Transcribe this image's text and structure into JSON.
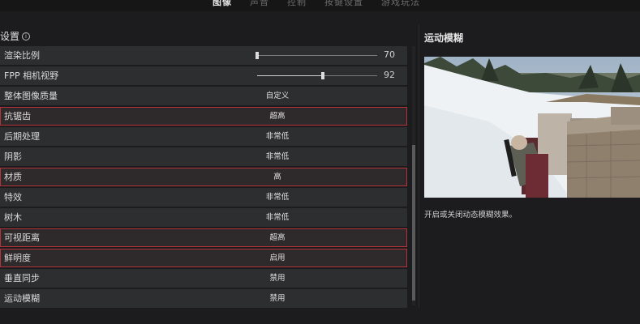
{
  "tabs": [
    {
      "label": "图像",
      "active": true
    },
    {
      "label": "声音",
      "active": false
    },
    {
      "label": "控制",
      "active": false
    },
    {
      "label": "按键设置",
      "active": false
    },
    {
      "label": "游戏玩法",
      "active": false
    }
  ],
  "section": {
    "title": "设置",
    "info_icon": "info-icon"
  },
  "settings": [
    {
      "label": "渲染比例",
      "type": "slider",
      "value": "70",
      "fraction": 0.0
    },
    {
      "label": "FPP 相机视野",
      "type": "slider",
      "value": "92",
      "fraction": 0.55
    },
    {
      "label": "整体图像质量",
      "value": "自定义",
      "highlighted": false
    },
    {
      "label": "抗锯齿",
      "value": "超高",
      "highlighted": true
    },
    {
      "label": "后期处理",
      "value": "非常低",
      "highlighted": false
    },
    {
      "label": "阴影",
      "value": "非常低",
      "highlighted": false
    },
    {
      "label": "材质",
      "value": "高",
      "highlighted": true
    },
    {
      "label": "特效",
      "value": "非常低",
      "highlighted": false
    },
    {
      "label": "树木",
      "value": "非常低",
      "highlighted": false
    },
    {
      "label": "可视距离",
      "value": "超高",
      "highlighted": true
    },
    {
      "label": "鲜明度",
      "value": "启用",
      "highlighted": true
    },
    {
      "label": "垂直同步",
      "value": "禁用",
      "highlighted": false
    },
    {
      "label": "运动模糊",
      "value": "禁用",
      "highlighted": false
    }
  ],
  "detail": {
    "title": "运动模糊",
    "description": "开启或关闭动态模糊效果。"
  },
  "colors": {
    "background": "#1c1c1e",
    "row": "#2d2e30",
    "highlight_border": "#b2343a"
  }
}
